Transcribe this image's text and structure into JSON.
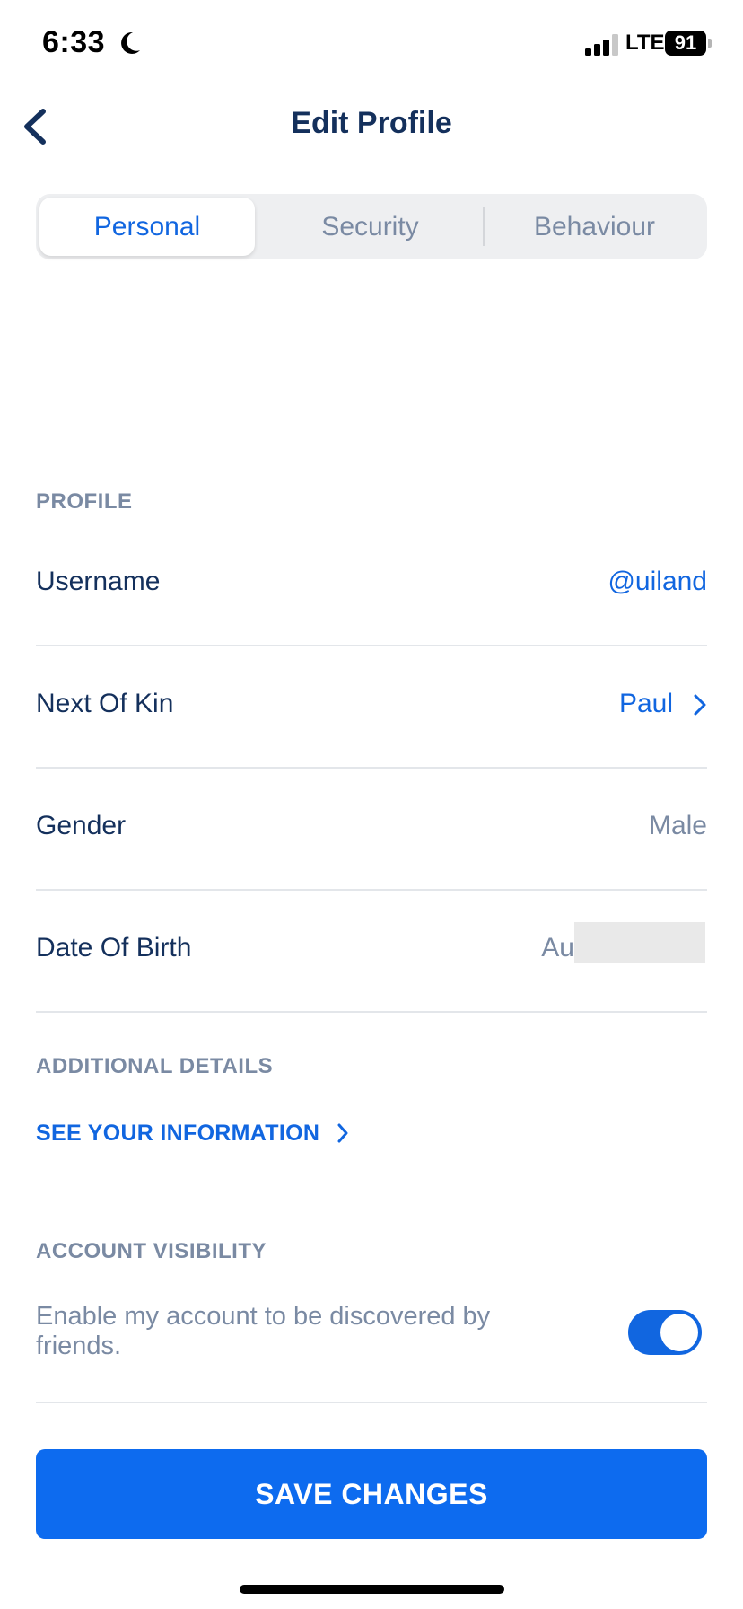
{
  "status_bar": {
    "time": "6:33",
    "network": "LTE",
    "battery": "91"
  },
  "header": {
    "title": "Edit Profile"
  },
  "tabs": [
    {
      "label": "Personal",
      "active": true
    },
    {
      "label": "Security",
      "active": false
    },
    {
      "label": "Behaviour",
      "active": false
    }
  ],
  "profile": {
    "section_title": "PROFILE",
    "rows": [
      {
        "label": "Username",
        "value": "@uiland"
      },
      {
        "label": "Next Of Kin",
        "value": "Paul"
      },
      {
        "label": "Gender",
        "value": "Male"
      },
      {
        "label": "Date Of Birth",
        "value": "Au"
      }
    ]
  },
  "additional": {
    "section_title": "ADDITIONAL DETAILS",
    "link_label": "SEE YOUR INFORMATION"
  },
  "visibility": {
    "section_title": "ACCOUNT VISIBILITY",
    "description": "Enable my account to be discovered by friends.",
    "toggle_on": true
  },
  "save_button": {
    "label": "SAVE CHANGES"
  },
  "colors": {
    "accent": "#1166e0",
    "text_primary": "#14305c",
    "text_secondary": "#7a8aa3"
  }
}
